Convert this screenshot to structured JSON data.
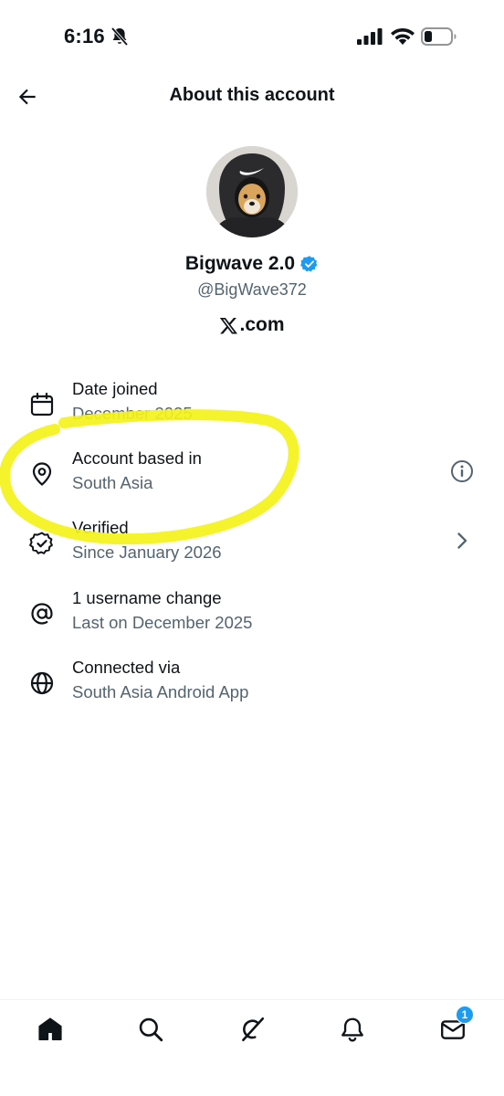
{
  "status_bar": {
    "time": "6:16",
    "icons": [
      "bell-slash-icon",
      "cellular-signal-icon",
      "wifi-icon",
      "battery-icon"
    ]
  },
  "header": {
    "title": "About this account",
    "back_icon": "arrow-left-icon"
  },
  "profile": {
    "display_name": "Bigwave 2.0",
    "verified": true,
    "verified_color": "#1d9bf0",
    "handle": "@BigWave372",
    "site_text": ".com"
  },
  "info_items": [
    {
      "icon": "calendar-icon",
      "label": "Date joined",
      "value": "December 2025"
    },
    {
      "icon": "location-pin-icon",
      "label": "Account based in",
      "value": "South Asia",
      "trailing": "info-circle-icon"
    },
    {
      "icon": "verified-check-icon",
      "label": "Verified",
      "value": "Since January 2026",
      "trailing": "chevron-right-icon"
    },
    {
      "icon": "at-sign-icon",
      "label": "1 username change",
      "value": "Last on December 2025"
    },
    {
      "icon": "globe-icon",
      "label": "Connected via",
      "value": "South Asia Android App"
    }
  ],
  "annotation": {
    "type": "highlighter-circle",
    "color": "#f4f21a"
  },
  "bottom_nav": {
    "items": [
      "home-icon",
      "search-icon",
      "grok-icon",
      "notifications-icon",
      "messages-icon"
    ],
    "messages_badge": "1",
    "badge_color": "#1d9bf0"
  }
}
